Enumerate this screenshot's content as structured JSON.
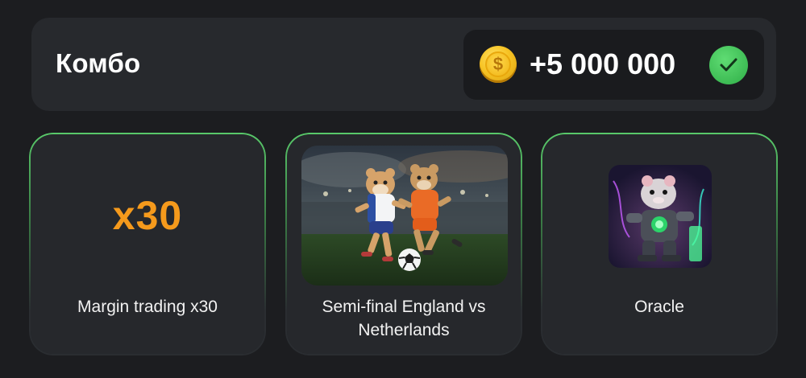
{
  "combo": {
    "title": "Комбо",
    "reward": "+5 000 000",
    "coin_icon": "$"
  },
  "cards": [
    {
      "big_text": "x30",
      "label": "Margin trading x30"
    },
    {
      "label": "Semi-final England vs Netherlands"
    },
    {
      "label": "Oracle"
    }
  ],
  "colors": {
    "accent_orange": "#f59a1c",
    "accent_green": "#3fbf56",
    "card_bg": "#26282c",
    "page_bg": "#1c1d20"
  }
}
